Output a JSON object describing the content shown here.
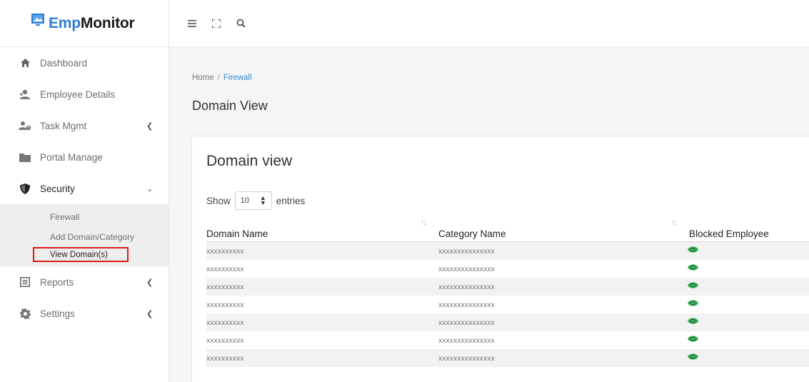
{
  "app": {
    "brand_prefix": "Emp",
    "brand_suffix": "Monitor"
  },
  "sidebar": {
    "items": [
      {
        "label": "Dashboard",
        "icon": "home-icon"
      },
      {
        "label": "Employee Details",
        "icon": "employee-icon"
      },
      {
        "label": "Task Mgmt",
        "icon": "users-icon"
      },
      {
        "label": "Portal Manage",
        "icon": "folder-icon"
      },
      {
        "label": "Security",
        "icon": "shield-icon"
      },
      {
        "label": "Reports",
        "icon": "report-icon"
      },
      {
        "label": "Settings",
        "icon": "gear-icon"
      }
    ],
    "security_submenu": [
      "Firewall",
      "Add Domain/Category",
      "View Domain(s)"
    ]
  },
  "topbar": {
    "icons": [
      "menu-icon",
      "fullscreen-icon",
      "search-icon"
    ]
  },
  "breadcrumb": {
    "home": "Home",
    "separator": "/",
    "current": "Firewall"
  },
  "page": {
    "title": "Domain View"
  },
  "card": {
    "title": "Domain view",
    "length": {
      "show": "Show",
      "value": "10",
      "entries": "entries"
    }
  },
  "table": {
    "columns": [
      "Domain Name",
      "Category Name",
      "Blocked Employee"
    ],
    "rows": [
      {
        "domain": "xxxxxxxxxx",
        "category": "xxxxxxxxxxxxxxx"
      },
      {
        "domain": "xxxxxxxxxx",
        "category": "xxxxxxxxxxxxxxx"
      },
      {
        "domain": "xxxxxxxxxx",
        "category": "xxxxxxxxxxxxxxx"
      },
      {
        "domain": "xxxxxxxxxx",
        "category": "xxxxxxxxxxxxxxx"
      },
      {
        "domain": "xxxxxxxxxx",
        "category": "xxxxxxxxxxxxxxx"
      },
      {
        "domain": "xxxxxxxxxx",
        "category": "xxxxxxxxxxxxxxx"
      },
      {
        "domain": "xxxxxxxxxx",
        "category": "xxxxxxxxxxxxxxx"
      }
    ]
  },
  "colors": {
    "brand": "#2e7bd6",
    "link": "#2f8ccf",
    "eye": "#2aa84a",
    "highlight": "#e01919"
  }
}
